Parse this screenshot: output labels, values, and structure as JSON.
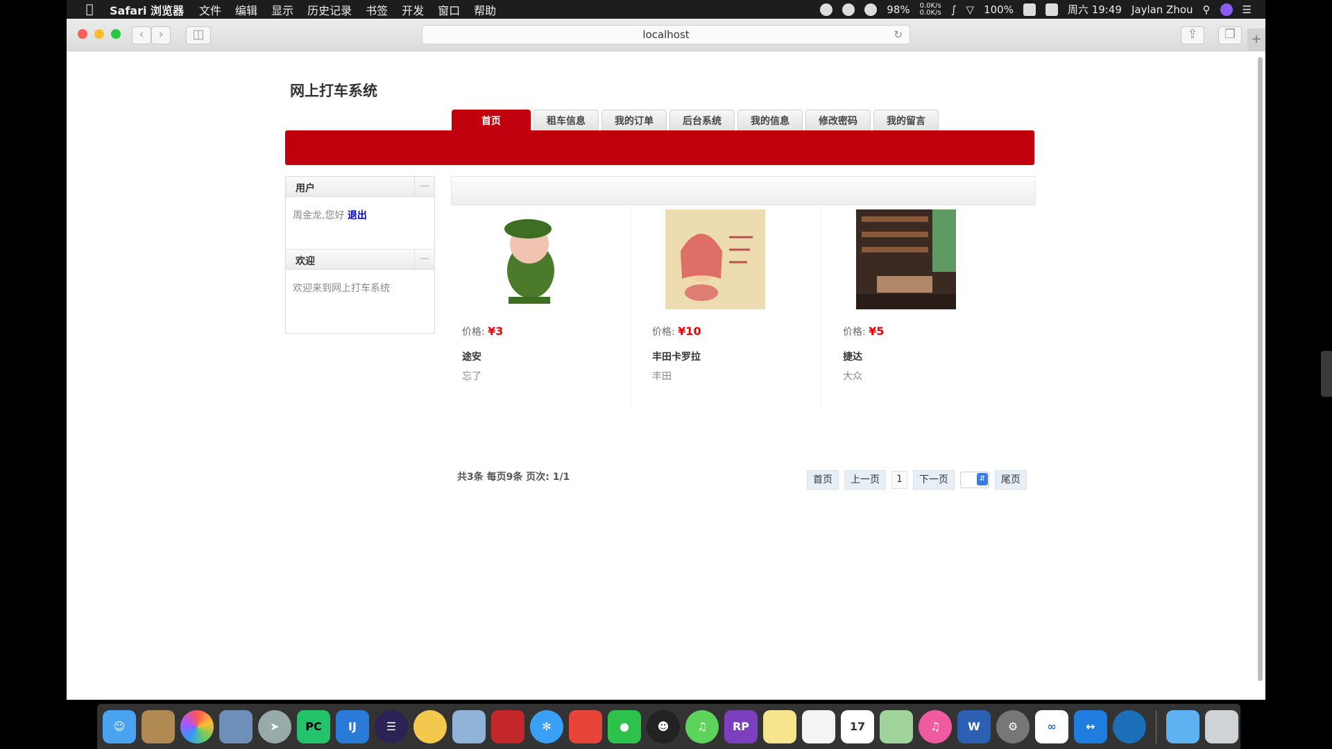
{
  "menubar": {
    "apple": "",
    "app_name": "Safari 浏览器",
    "items": [
      "文件",
      "编辑",
      "显示",
      "历史记录",
      "书签",
      "开发",
      "窗口",
      "帮助"
    ],
    "battery_pct": "98%",
    "net_up": "0.0K/s",
    "net_down": "0.0K/s",
    "wifi_pct": "100%",
    "datetime": "周六 19:49",
    "user": "Jaylan Zhou"
  },
  "browser": {
    "address": "localhost"
  },
  "site": {
    "title": "网上打车系统",
    "nav": [
      "首页",
      "租车信息",
      "我的订单",
      "后台系统",
      "我的信息",
      "修改密码",
      "我的留言"
    ],
    "active_nav": "首页"
  },
  "sidebar": {
    "user_panel": {
      "title": "用户",
      "greeting": "周金龙,您好",
      "logout": "退出"
    },
    "welcome_panel": {
      "title": "欢迎",
      "text": "欢迎来到网上打车系统"
    },
    "minimize_symbol": "—"
  },
  "cars": [
    {
      "price_label": "价格:",
      "price": "¥3",
      "name": "途安",
      "brand": "忘了"
    },
    {
      "price_label": "价格:",
      "price": "¥10",
      "name": "丰田卡罗拉",
      "brand": "丰田"
    },
    {
      "price_label": "价格:",
      "price": "¥5",
      "name": "捷达",
      "brand": "大众"
    }
  ],
  "pagination": {
    "info": "共3条 每页9条 页次: 1/1",
    "first": "首页",
    "prev": "上一页",
    "current": "1",
    "next": "下一页",
    "last": "尾页"
  },
  "colors": {
    "accent_red": "#c0000c",
    "price_red": "#ee0000",
    "link_blue": "#0000dd"
  },
  "dock": [
    "finder",
    "notes-brown",
    "photos",
    "preview",
    "launchpad",
    "pycharm",
    "intellij",
    "eclipse",
    "chicken",
    "database",
    "stack",
    "safari",
    "presenter",
    "wechat",
    "qq",
    "music-green",
    "axure-rp",
    "notes",
    "reminders",
    "calendar",
    "maps",
    "itunes",
    "word",
    "system-prefs",
    "baidu-cloud",
    "teamviewer",
    "edge",
    "downloads-folder",
    "trash"
  ]
}
